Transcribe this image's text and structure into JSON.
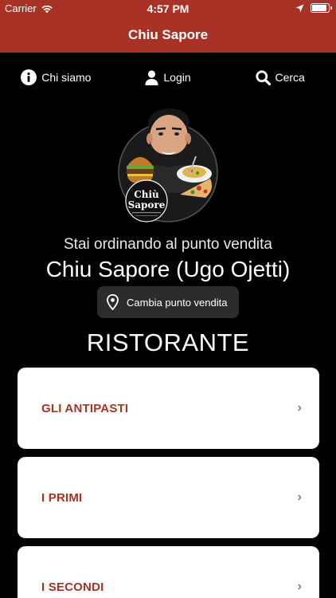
{
  "status_bar": {
    "carrier": "Carrier",
    "time": "4:57 PM"
  },
  "navbar": {
    "title": "Chiu Sapore"
  },
  "actions": [
    {
      "label": "Chi siamo",
      "icon": "info-icon"
    },
    {
      "label": "Login",
      "icon": "user-icon"
    },
    {
      "label": "Cerca",
      "icon": "search-icon"
    }
  ],
  "logo": {
    "name_line1": "Chiù",
    "name_line2": "Sapore"
  },
  "store": {
    "ordering_text": "Stai ordinando al punto vendita",
    "name": "Chiu Sapore (Ugo Ojetti)",
    "change_label": "Cambia punto vendita"
  },
  "section_title": "RISTORANTE",
  "categories": [
    {
      "label": "GLI ANTIPASTI"
    },
    {
      "label": "I PRIMI"
    },
    {
      "label": "I SECONDI"
    }
  ],
  "colors": {
    "brand": "#a83226",
    "background": "#000000",
    "card": "#ffffff"
  }
}
